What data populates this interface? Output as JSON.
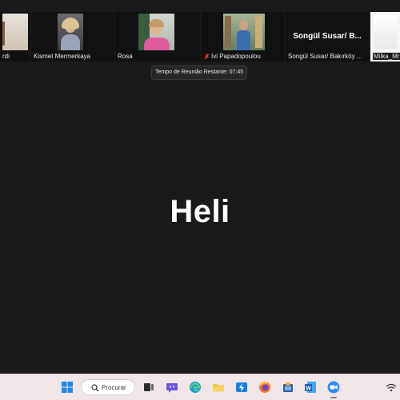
{
  "participants": [
    {
      "name": "rdi"
    },
    {
      "name": "Kismet Mermerkaya"
    },
    {
      "name": "Rosa"
    },
    {
      "name": "Ivi Papadopoulou",
      "muted": true
    },
    {
      "name": "Songül Susar/ Bakırköy ...",
      "title": "Songül Susar/ B..."
    },
    {
      "name": "Milka_Mr"
    }
  ],
  "tooltip": "Tempo de Reunião Restante: 07:45",
  "speaker": "Heli",
  "taskbar": {
    "search_label": "Procurar",
    "icons": [
      "windows-start-icon",
      "search-icon",
      "task-view-icon",
      "chat-icon",
      "edge-icon",
      "file-explorer-icon",
      "store-icon",
      "firefox-icon",
      "app-icon",
      "word-icon",
      "zoom-icon"
    ]
  }
}
